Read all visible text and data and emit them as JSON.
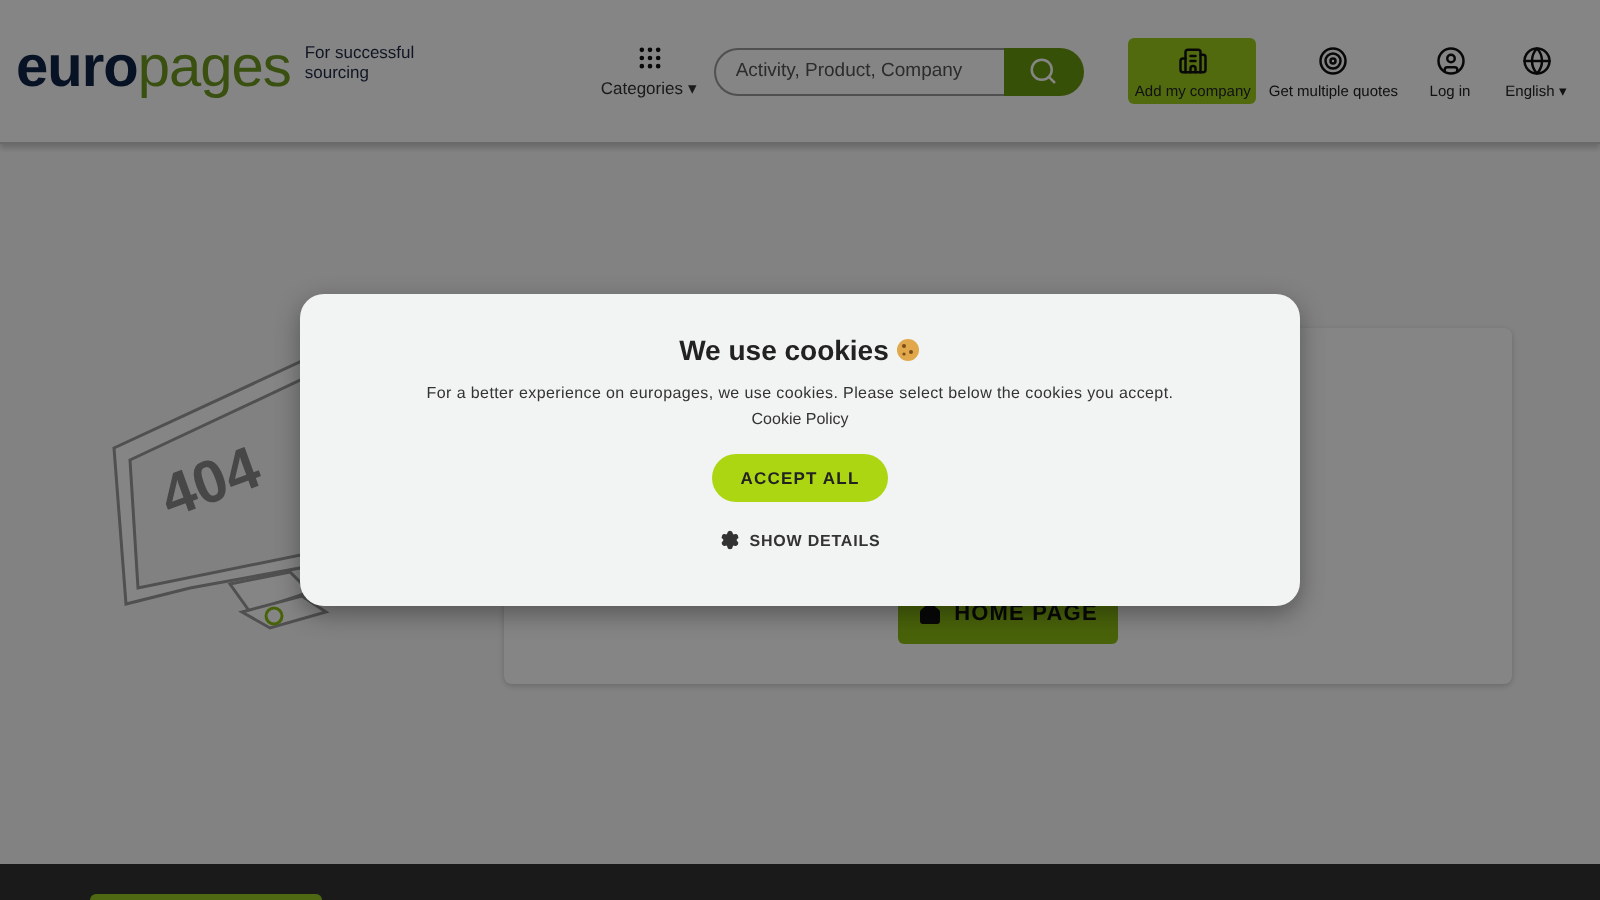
{
  "header": {
    "logo": {
      "first": "euro",
      "second": "pages"
    },
    "tagline": "For successful sourcing",
    "categories": {
      "label": "Categories",
      "caret": "▾"
    },
    "search": {
      "placeholder": "Activity, Product, Company"
    },
    "nav": [
      {
        "label": "Add my company",
        "kind": "building",
        "highlighted": true
      },
      {
        "label": "Get multiple quotes",
        "kind": "target",
        "highlighted": false
      },
      {
        "label": "Log in",
        "kind": "user",
        "highlighted": false
      },
      {
        "label": "English",
        "kind": "globe",
        "highlighted": false,
        "caret": "▾"
      }
    ]
  },
  "error_page": {
    "illustration_text": "404",
    "home_button": "HOME PAGE"
  },
  "cookie_dialog": {
    "title": "We use cookies",
    "text": "For a better experience on europages, we use cookies. Please select below the cookies you accept.",
    "policy_link": "Cookie Policy",
    "accept_button": "ACCEPT ALL",
    "details_button": "SHOW DETAILS"
  }
}
